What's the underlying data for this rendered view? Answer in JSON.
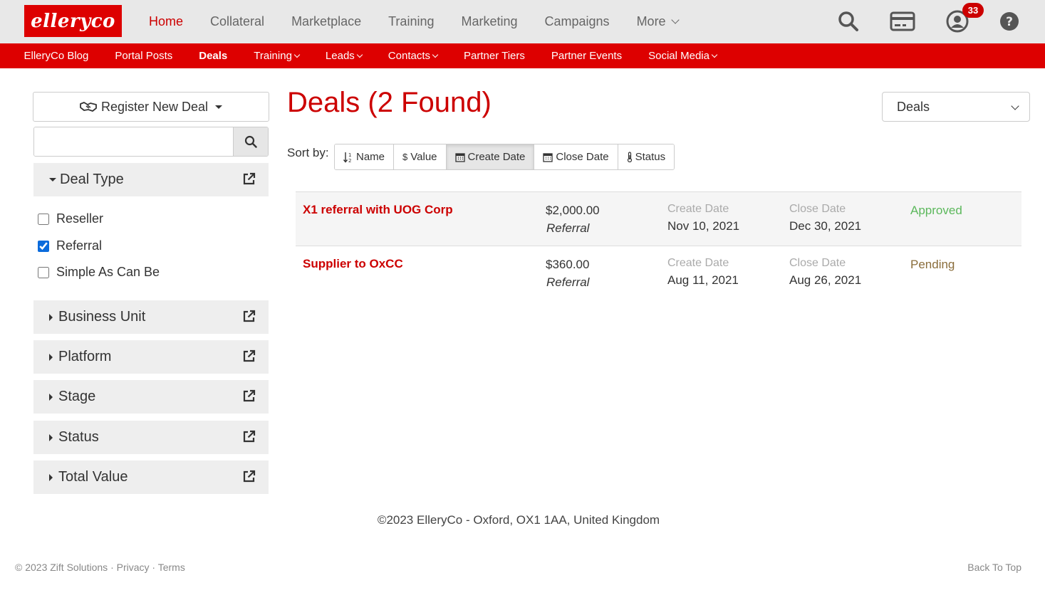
{
  "brand": {
    "logo_text": "elleryco",
    "accent": "#dd0000",
    "link_red": "#cc0000"
  },
  "main_nav": [
    {
      "label": "Home",
      "active": true
    },
    {
      "label": "Collateral"
    },
    {
      "label": "Marketplace"
    },
    {
      "label": "Training"
    },
    {
      "label": "Marketing"
    },
    {
      "label": "Campaigns"
    },
    {
      "label": "More",
      "dropdown": true
    }
  ],
  "top_icons": {
    "search": "search-icon",
    "card": "credit-card-icon",
    "user": "user-icon",
    "help": "help-icon",
    "notification_count": "33"
  },
  "sub_nav": [
    {
      "label": "ElleryCo Blog"
    },
    {
      "label": "Portal Posts"
    },
    {
      "label": "Deals",
      "active": true
    },
    {
      "label": "Training",
      "dropdown": true
    },
    {
      "label": "Leads",
      "dropdown": true
    },
    {
      "label": "Contacts",
      "dropdown": true
    },
    {
      "label": "Partner Tiers"
    },
    {
      "label": "Partner Events"
    },
    {
      "label": "Social Media",
      "dropdown": true
    }
  ],
  "sidebar": {
    "register_label": "Register New Deal",
    "search_placeholder": "",
    "deal_type": {
      "label": "Deal Type",
      "options": [
        {
          "label": "Reseller",
          "checked": false
        },
        {
          "label": "Referral",
          "checked": true
        },
        {
          "label": "Simple As Can Be",
          "checked": false
        }
      ]
    },
    "facets": [
      "Business Unit",
      "Platform",
      "Stage",
      "Status",
      "Total Value"
    ]
  },
  "main": {
    "heading": "Deals (2 Found)",
    "view_select": "Deals",
    "sort_label": "Sort by:",
    "sort_options": [
      {
        "label": "Name",
        "icon": "sort-alpha-icon"
      },
      {
        "label": "Value",
        "icon": "dollar-icon"
      },
      {
        "label": "Create Date",
        "icon": "calendar-icon",
        "active": true
      },
      {
        "label": "Close Date",
        "icon": "calendar-icon"
      },
      {
        "label": "Status",
        "icon": "thermometer-icon"
      }
    ],
    "create_date_label": "Create Date",
    "close_date_label": "Close Date",
    "deals": [
      {
        "name": "X1 referral with UOG Corp",
        "value": "$2,000.00",
        "type": "Referral",
        "create_date": "Nov 10, 2021",
        "close_date": "Dec 30, 2021",
        "status": "Approved",
        "status_color": "#5cb85c"
      },
      {
        "name": "Supplier to OxCC",
        "value": "$360.00",
        "type": "Referral",
        "create_date": "Aug 11, 2021",
        "close_date": "Aug 26, 2021",
        "status": "Pending",
        "status_color": "#8a6d3b"
      }
    ]
  },
  "footer": {
    "address": "©2023 ElleryCo - Oxford, OX1 1AA, United Kingdom",
    "copyright": "© 2023 Zift Solutions",
    "privacy": "Privacy",
    "terms": "Terms",
    "sep": "·",
    "back_to_top": "Back To Top"
  }
}
